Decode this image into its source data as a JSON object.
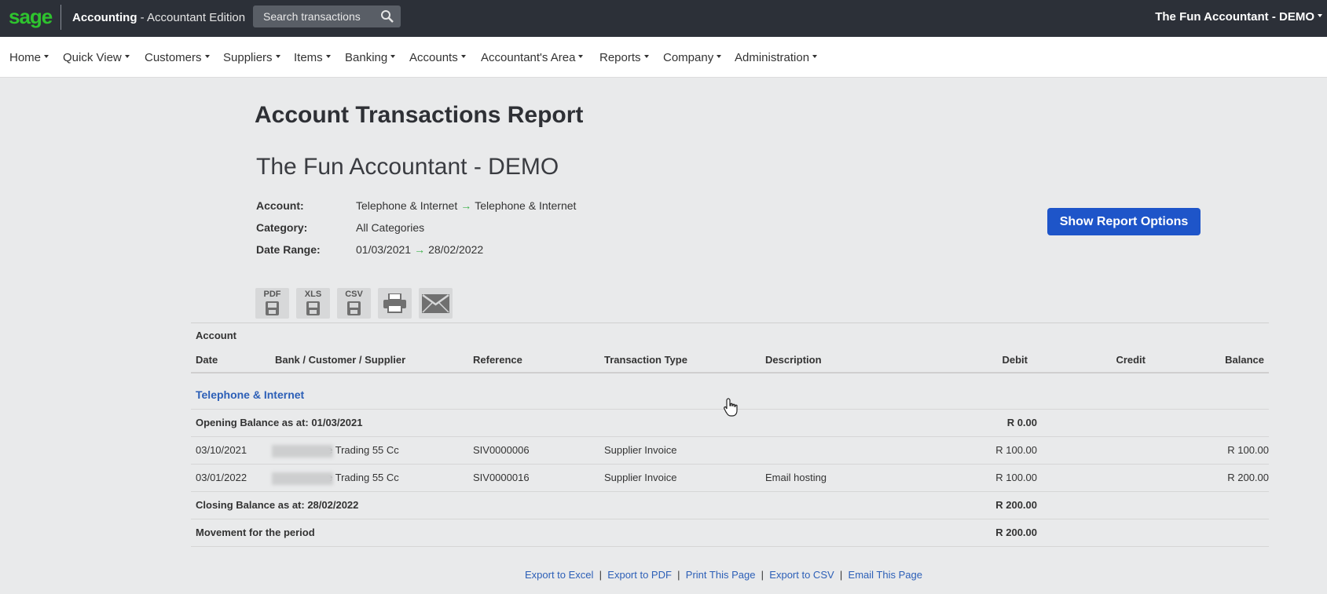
{
  "topbar": {
    "logo": "sage",
    "app_name": "Accounting",
    "app_edition": "- Accountant Edition",
    "search_placeholder": "Search transactions",
    "company_menu": "The Fun Accountant - DEMO"
  },
  "nav": [
    "Home",
    "Quick View",
    "Customers",
    "Suppliers",
    "Items",
    "Banking",
    "Accounts",
    "Accountant's Area",
    "Reports",
    "Company",
    "Administration"
  ],
  "report": {
    "title": "Account Transactions Report",
    "company": "The Fun Accountant - DEMO",
    "account_label": "Account:",
    "account_from": "Telephone & Internet",
    "account_to": "Telephone & Internet",
    "category_label": "Category:",
    "category_value": "All Categories",
    "date_range_label": "Date Range:",
    "date_from": "01/03/2021",
    "date_to": "28/02/2022",
    "options_button": "Show Report Options",
    "arrow": "→"
  },
  "tools": [
    "PDF",
    "XLS",
    "CSV"
  ],
  "table": {
    "header_account": "Account",
    "columns": [
      "Date",
      "Bank / Customer / Supplier",
      "Reference",
      "Transaction Type",
      "Description",
      "Debit",
      "Credit",
      "Balance"
    ],
    "group_name": "Telephone & Internet",
    "opening_label": "Opening Balance as at: 01/03/2021",
    "opening_debit": "R 0.00",
    "rows": [
      {
        "date": "03/10/2021",
        "party": "e Trading 55 Cc",
        "reference": "SIV0000006",
        "type": "Supplier Invoice",
        "description": "",
        "debit": "R 100.00",
        "credit": "",
        "balance": "R 100.00"
      },
      {
        "date": "03/01/2022",
        "party": "e Trading 55 Cc",
        "reference": "SIV0000016",
        "type": "Supplier Invoice",
        "description": "Email hosting",
        "debit": "R 100.00",
        "credit": "",
        "balance": "R 200.00"
      }
    ],
    "closing_label": "Closing Balance as at: 28/02/2022",
    "closing_debit": "R 200.00",
    "movement_label": "Movement for the period",
    "movement_debit": "R 200.00"
  },
  "footer": {
    "links": [
      "Export to Excel",
      "Export to PDF",
      "Print This Page",
      "Export to CSV",
      "Email This Page"
    ],
    "separator": "|"
  }
}
